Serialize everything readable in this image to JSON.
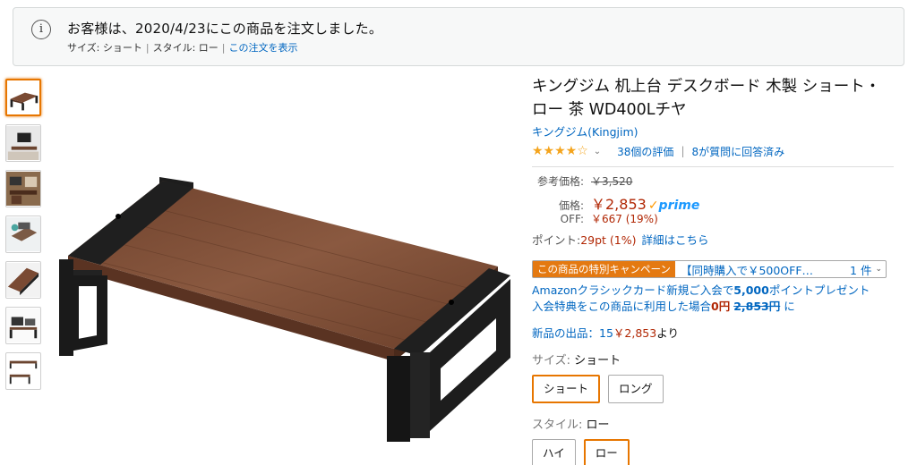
{
  "banner": {
    "icon": "info-icon",
    "icon_glyph": "i",
    "message": "お客様は、2020/4/23にこの商品を注文しました。",
    "size_label": "サイズ: ",
    "size_value": "ショート",
    "style_label": "スタイル: ",
    "style_value": "ロー",
    "separator": "|",
    "view_order_link": "この注文を表示"
  },
  "thumbnails": [
    {
      "name": "desk-board-brown"
    },
    {
      "name": "monitor-setup"
    },
    {
      "name": "desk-scene"
    },
    {
      "name": "laptop-desk"
    },
    {
      "name": "board-closeup"
    },
    {
      "name": "dimension-diagram"
    },
    {
      "name": "size-comparison"
    }
  ],
  "product": {
    "title": "キングジム 机上台 デスクボード 木製 ショート・ロー 茶 WD400Lチヤ",
    "brand": "キングジム(Kingjim)",
    "stars": "★★★★☆",
    "rating_count": "38個の評価",
    "answered": "8が質問に回答済み"
  },
  "pricing": {
    "list_label": "参考価格:",
    "list_price": "￥3,520",
    "price_label": "価格:",
    "price": "￥2,853",
    "prime_label": "prime",
    "off_label": "OFF:",
    "off_value": "￥667 (19%)",
    "points_label": "ポイント:",
    "points_value": "29pt  (1%)",
    "points_link": "詳細はこちら"
  },
  "campaign": {
    "badge": "この商品の特別キャンペーン",
    "text": "【同時購入で￥500OFF…",
    "count": "1 件"
  },
  "card_promo": {
    "line1_a": "Amazonクラシックカード新規ご入会で",
    "line1_bold": "5,000",
    "line1_b": "ポイントプレゼント",
    "line2_a": "入会特典をこの商品に利用した場合",
    "line2_red": "0円",
    "line2_strike": "2,853円",
    "line2_b": " に"
  },
  "new_offers": {
    "label": "新品の出品：15",
    "price": "￥2,853",
    "tail": "より"
  },
  "size": {
    "label": "サイズ: ",
    "selected": "ショート",
    "options": [
      "ショート",
      "ロング"
    ]
  },
  "style": {
    "label": "スタイル: ",
    "selected": "ロー",
    "options": [
      "ハイ",
      "ロー"
    ]
  },
  "colors": {
    "link": "#0066c0",
    "price_red": "#b12704",
    "orange_accent": "#e77600",
    "prime_blue": "#1a98ff",
    "star": "#f4a41d"
  }
}
